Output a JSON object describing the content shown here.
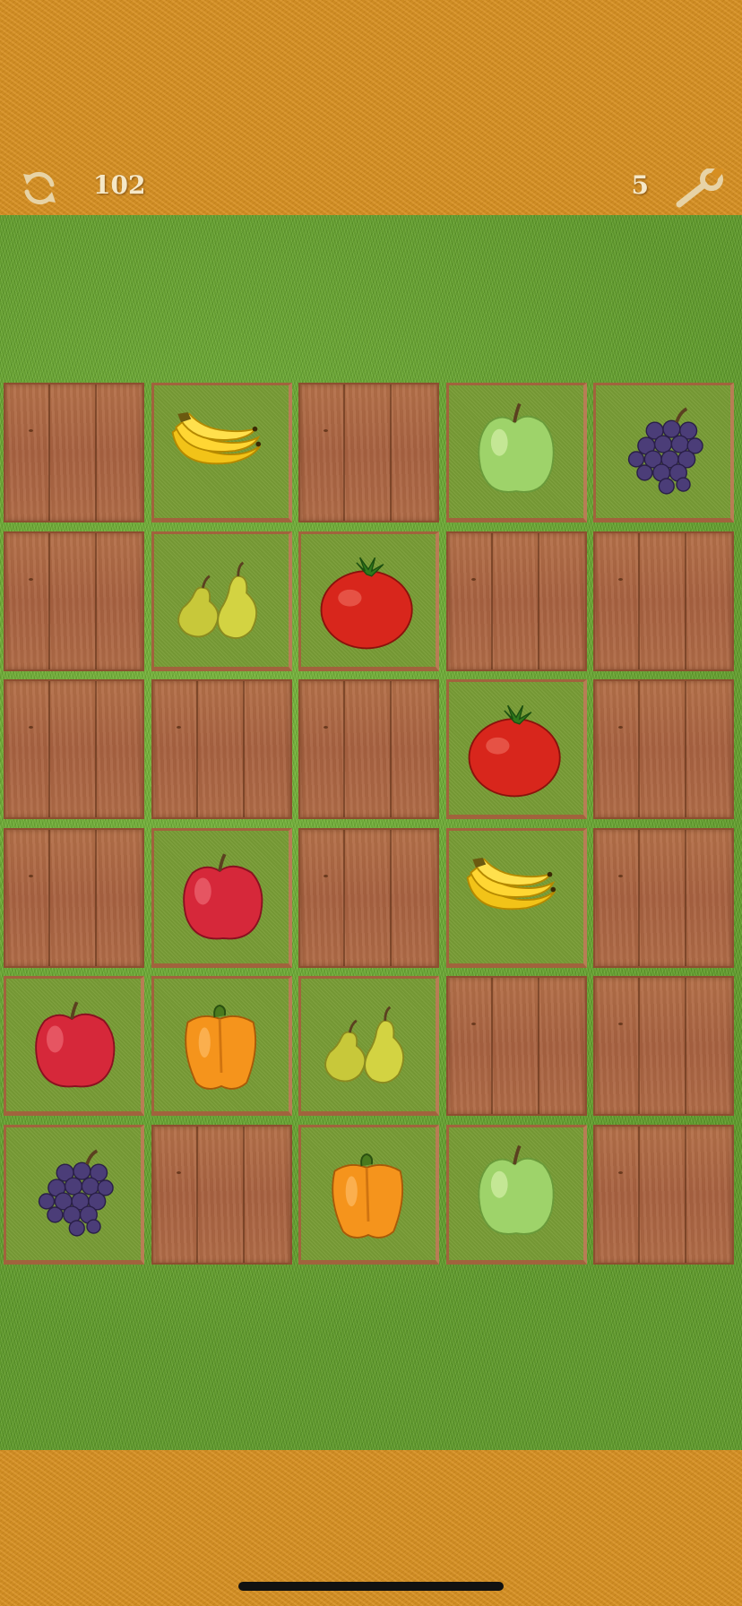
{
  "hud": {
    "score": "102",
    "level": "5",
    "refresh_icon": "refresh-icon",
    "settings_icon": "wrench-icon"
  },
  "board": {
    "rows": 6,
    "cols": 5,
    "tiles": [
      [
        "hidden",
        "banana",
        "hidden",
        "green-apple",
        "grapes"
      ],
      [
        "hidden",
        "pears",
        "tomato",
        "hidden",
        "hidden"
      ],
      [
        "hidden",
        "hidden",
        "hidden",
        "tomato",
        "hidden"
      ],
      [
        "hidden",
        "red-apple",
        "hidden",
        "banana",
        "hidden"
      ],
      [
        "red-apple",
        "bell-pepper",
        "pears",
        "hidden",
        "hidden"
      ],
      [
        "grapes",
        "hidden",
        "bell-pepper",
        "green-apple",
        "hidden"
      ]
    ]
  },
  "colors": {
    "bar": "#d68f22",
    "grass": "#5f9a2c",
    "tile_revealed": "#799d36",
    "tile_hidden": "#a86241"
  }
}
